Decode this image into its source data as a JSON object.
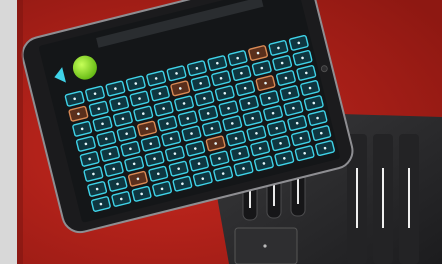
{
  "scene": {
    "description_free": true,
    "colors": {
      "background_red": "#b5231c",
      "tablet_bezel": "#1b1b1d",
      "grid_pad_cyan": "#3fd3e8",
      "grid_pad_orange": "#d98a55",
      "play_button_green": "#8ee02a",
      "controller_body": "#2a2a2c"
    },
    "tablet": {
      "icons": [
        "left-arrow-icon",
        "play-button-icon",
        "camera-icon"
      ],
      "grid": {
        "rows": 8,
        "cols": 12,
        "orange_cells": [
          [
            0,
            9
          ],
          [
            1,
            0
          ],
          [
            1,
            5
          ],
          [
            2,
            9
          ],
          [
            3,
            3
          ],
          [
            5,
            6
          ],
          [
            6,
            2
          ]
        ]
      }
    },
    "controller": {
      "sliders": 3,
      "ribbons": 3
    }
  }
}
